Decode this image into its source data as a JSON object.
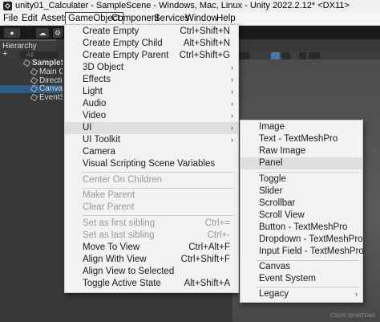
{
  "window": {
    "title": "unity01_Calculater - SampleScene - Windows, Mac, Linux - Unity 2022.2.12* <DX11>"
  },
  "menubar": [
    "File",
    "Edit",
    "Assets",
    "GameObject",
    "Component",
    "Services",
    "Window",
    "Help"
  ],
  "toolbar": {
    "account_label": "▾"
  },
  "hierarchy": {
    "tab_label": "Hierarchy",
    "add_label": "+",
    "search_placeholder": "All",
    "rows": [
      "SampleSc",
      "Main Ca",
      "Directio",
      "Canvas",
      "EventSy"
    ]
  },
  "gameobject_menu": [
    {
      "label": "Create Empty",
      "shortcut": "Ctrl+Shift+N",
      "submenu": false,
      "enabled": true
    },
    {
      "label": "Create Empty Child",
      "shortcut": "Alt+Shift+N",
      "submenu": false,
      "enabled": true
    },
    {
      "label": "Create Empty Parent",
      "shortcut": "Ctrl+Shift+G",
      "submenu": false,
      "enabled": true
    },
    {
      "label": "3D Object",
      "shortcut": "",
      "submenu": true,
      "enabled": true
    },
    {
      "label": "Effects",
      "shortcut": "",
      "submenu": true,
      "enabled": true
    },
    {
      "label": "Light",
      "shortcut": "",
      "submenu": true,
      "enabled": true
    },
    {
      "label": "Audio",
      "shortcut": "",
      "submenu": true,
      "enabled": true
    },
    {
      "label": "Video",
      "shortcut": "",
      "submenu": true,
      "enabled": true
    },
    {
      "label": "UI",
      "shortcut": "",
      "submenu": true,
      "enabled": true,
      "highlighted": true
    },
    {
      "label": "UI Toolkit",
      "shortcut": "",
      "submenu": true,
      "enabled": true
    },
    {
      "label": "Camera",
      "shortcut": "",
      "submenu": false,
      "enabled": true
    },
    {
      "label": "Visual Scripting Scene Variables",
      "shortcut": "",
      "submenu": false,
      "enabled": true
    },
    {
      "separator": true
    },
    {
      "label": "Center On Children",
      "shortcut": "",
      "submenu": false,
      "enabled": false
    },
    {
      "separator": true
    },
    {
      "label": "Make Parent",
      "shortcut": "",
      "submenu": false,
      "enabled": false
    },
    {
      "label": "Clear Parent",
      "shortcut": "",
      "submenu": false,
      "enabled": false
    },
    {
      "separator": true
    },
    {
      "label": "Set as first sibling",
      "shortcut": "Ctrl+=",
      "submenu": false,
      "enabled": false
    },
    {
      "label": "Set as last sibling",
      "shortcut": "Ctrl+-",
      "submenu": false,
      "enabled": false
    },
    {
      "label": "Move To View",
      "shortcut": "Ctrl+Alt+F",
      "submenu": false,
      "enabled": true
    },
    {
      "label": "Align With View",
      "shortcut": "Ctrl+Shift+F",
      "submenu": false,
      "enabled": true
    },
    {
      "label": "Align View to Selected",
      "shortcut": "",
      "submenu": false,
      "enabled": true
    },
    {
      "label": "Toggle Active State",
      "shortcut": "Alt+Shift+A",
      "submenu": false,
      "enabled": true
    }
  ],
  "ui_submenu": [
    {
      "label": "Image"
    },
    {
      "label": "Text - TextMeshPro"
    },
    {
      "label": "Raw Image"
    },
    {
      "label": "Panel",
      "highlighted": true
    },
    {
      "separator": true
    },
    {
      "label": "Toggle"
    },
    {
      "label": "Slider"
    },
    {
      "label": "Scrollbar"
    },
    {
      "label": "Scroll View"
    },
    {
      "label": "Button - TextMeshPro"
    },
    {
      "label": "Dropdown - TextMeshPro"
    },
    {
      "label": "Input Field - TextMeshPro"
    },
    {
      "separator": true
    },
    {
      "label": "Canvas"
    },
    {
      "label": "Event System"
    },
    {
      "separator": true
    },
    {
      "label": "Legacy",
      "submenu": true
    }
  ],
  "watermark": "CSDN @HATEaR",
  "icons": {
    "submenu_arrow": "›"
  }
}
